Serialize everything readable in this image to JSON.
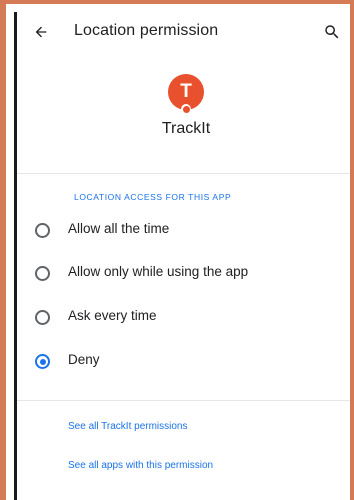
{
  "header": {
    "title": "Location permission",
    "back_icon": "arrow-back-icon",
    "search_icon": "search-icon"
  },
  "app": {
    "initial": "T",
    "name": "TrackIt",
    "avatar_color": "#e8502e"
  },
  "section": {
    "header": "LOCATION ACCESS FOR THIS APP"
  },
  "options": [
    {
      "label": "Allow all the time",
      "selected": false
    },
    {
      "label": "Allow only while using the app",
      "selected": false
    },
    {
      "label": "Ask every time",
      "selected": false
    },
    {
      "label": "Deny",
      "selected": true
    }
  ],
  "links": {
    "app_permissions": "See all TrackIt permissions",
    "all_apps": "See all apps with this permission"
  },
  "colors": {
    "accent": "#1a73e8",
    "frame": "#d47a55"
  }
}
